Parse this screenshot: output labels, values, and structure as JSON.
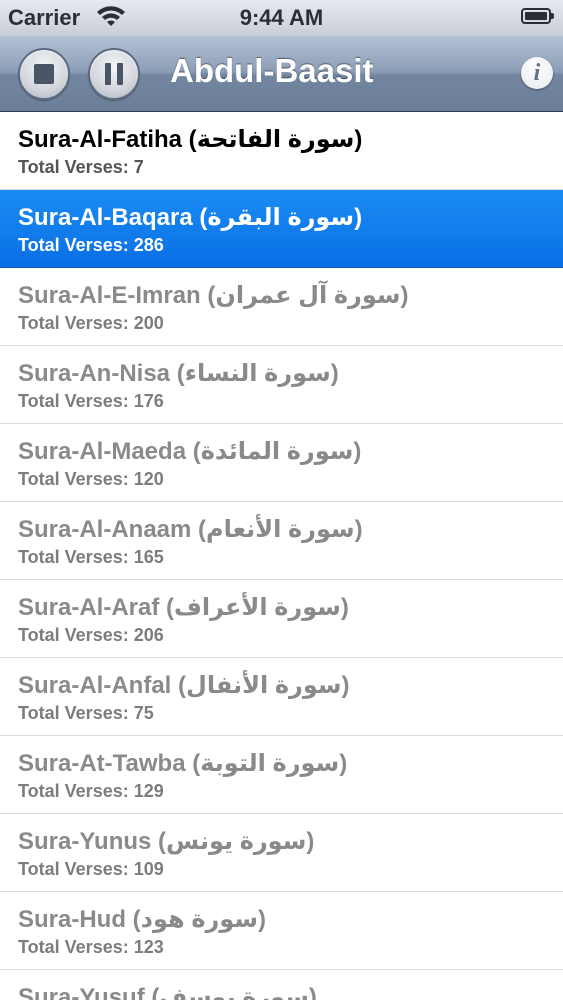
{
  "status_bar": {
    "carrier": "Carrier",
    "time": "9:44 AM"
  },
  "nav": {
    "title": "Abdul-Baasit",
    "info_glyph": "i",
    "icons": [
      "stop-icon",
      "pause-icon",
      "info-icon"
    ]
  },
  "colors": {
    "selected_row": "#0a6fe6",
    "nav_bar": "#7f93ad",
    "unplayed_text": "#8a8a8a"
  },
  "suras": [
    {
      "title": "Sura-Al-Fatiha (سورة الفاتحة)",
      "verses": "Total Verses: 7",
      "state": "played"
    },
    {
      "title": "Sura-Al-Baqara (سورة البقرة)",
      "verses": "Total Verses: 286",
      "state": "selected"
    },
    {
      "title": "Sura-Al-E-Imran (سورة آل عمران)",
      "verses": "Total Verses: 200",
      "state": "normal"
    },
    {
      "title": "Sura-An-Nisa (سورة النساء)",
      "verses": "Total Verses: 176",
      "state": "normal"
    },
    {
      "title": "Sura-Al-Maeda (سورة المائدة)",
      "verses": "Total Verses: 120",
      "state": "normal"
    },
    {
      "title": "Sura-Al-Anaam (سورة الأنعام)",
      "verses": "Total Verses: 165",
      "state": "normal"
    },
    {
      "title": "Sura-Al-Araf (سورة الأعراف)",
      "verses": "Total Verses: 206",
      "state": "normal"
    },
    {
      "title": "Sura-Al-Anfal (سورة الأنفال)",
      "verses": "Total Verses: 75",
      "state": "normal"
    },
    {
      "title": "Sura-At-Tawba (سورة التوبة)",
      "verses": "Total Verses: 129",
      "state": "normal"
    },
    {
      "title": "Sura-Yunus (سورة يونس)",
      "verses": "Total Verses: 109",
      "state": "normal"
    },
    {
      "title": "Sura-Hud (سورة هود)",
      "verses": "Total Verses: 123",
      "state": "normal"
    },
    {
      "title": "Sura-Yusuf (سورة يوسف)",
      "verses": "",
      "state": "normal"
    }
  ]
}
